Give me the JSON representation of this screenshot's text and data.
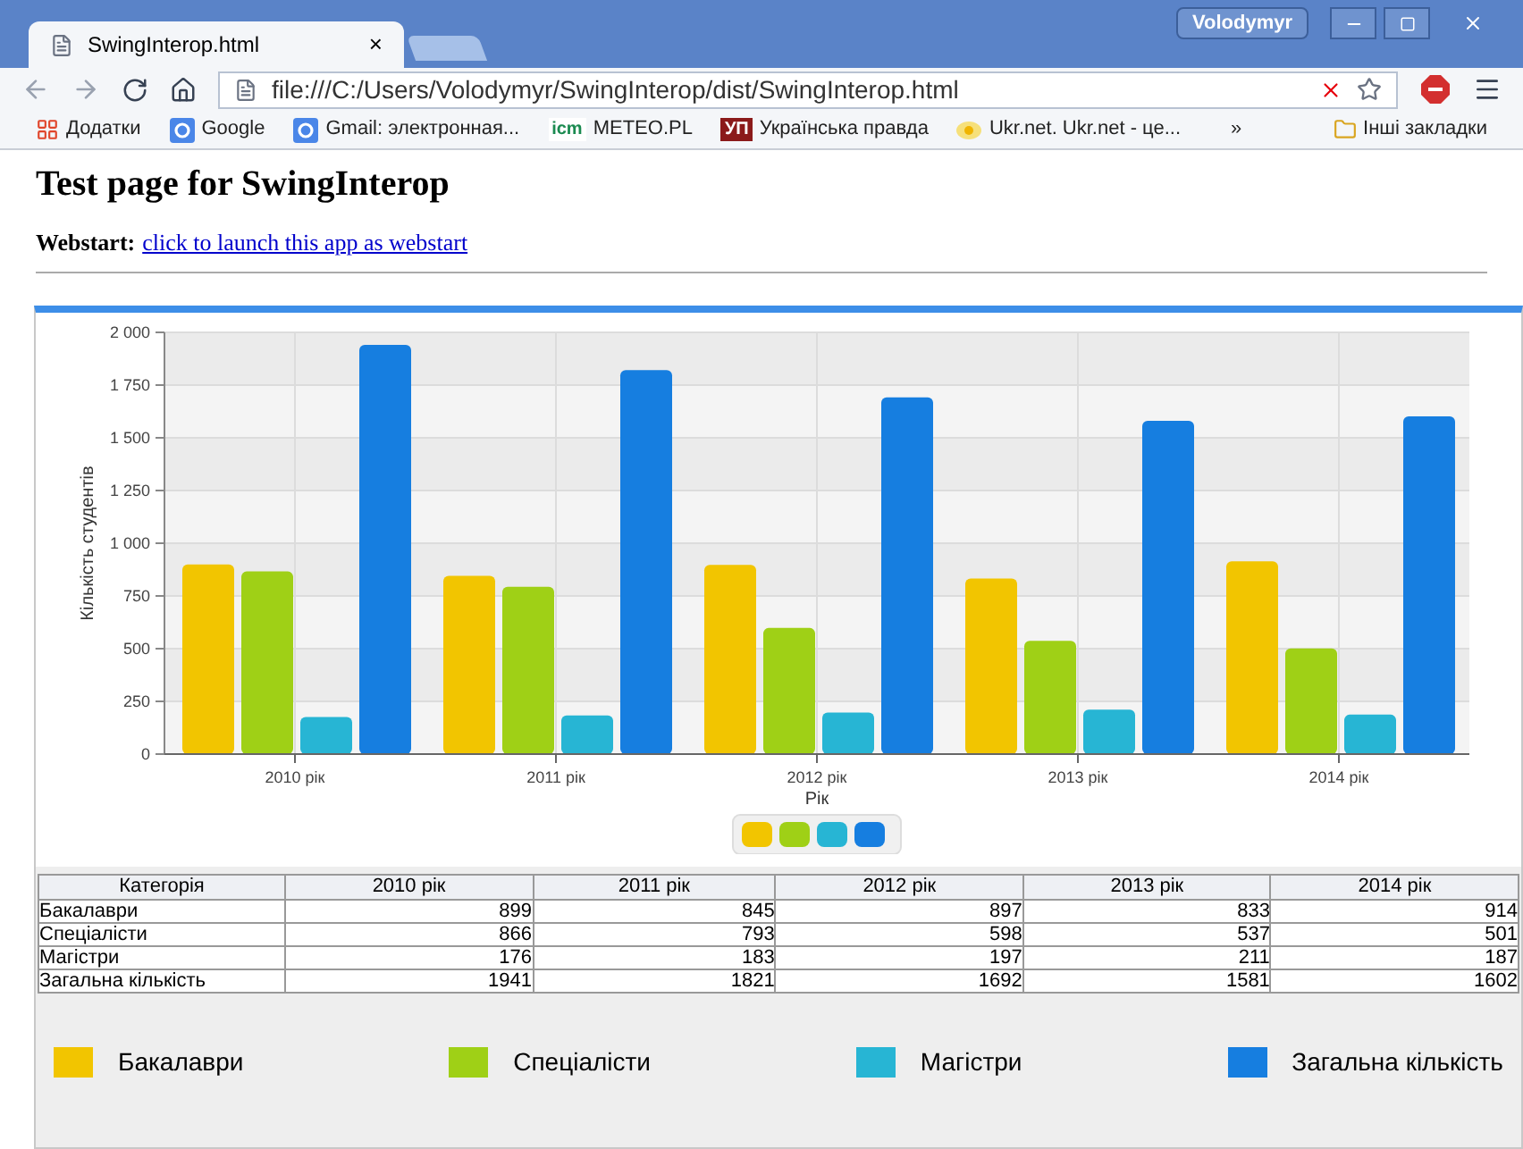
{
  "window": {
    "user": "Volodymyr"
  },
  "tab": {
    "title": "SwingInterop.html",
    "close": "×"
  },
  "address": "file:///C:/Users/Volodymyr/SwingInterop/dist/SwingInterop.html",
  "bookmarks": [
    {
      "kind": "apps",
      "label": "Додатки"
    },
    {
      "kind": "google",
      "label": "Google"
    },
    {
      "kind": "google",
      "label": "Gmail: электронная..."
    },
    {
      "kind": "icm",
      "badge": "icm",
      "label": "METEO.PL"
    },
    {
      "kind": "up",
      "badge": "УП",
      "label": "Українська правда"
    },
    {
      "kind": "ukr",
      "label": "Ukr.net. Ukr.net - це..."
    }
  ],
  "bookmarks_more": "»",
  "other_bookmarks": "Інші закладки",
  "page": {
    "heading": "Test page for SwingInterop",
    "webstart_label": "Webstart:",
    "webstart_link": "click to launch this app as webstart"
  },
  "chart": {
    "chart_data": {
      "type": "bar",
      "xlabel": "Рік",
      "ylabel": "Кількість студентів",
      "categories": [
        "2010 рік",
        "2011 рік",
        "2012 рік",
        "2013 рік",
        "2014 рік"
      ],
      "series": [
        {
          "name": "Бакалаври",
          "color": "#f2c500",
          "values": [
            899,
            845,
            897,
            833,
            914
          ]
        },
        {
          "name": "Спеціалісти",
          "color": "#9fd016",
          "values": [
            866,
            793,
            598,
            537,
            501
          ]
        },
        {
          "name": "Магістри",
          "color": "#27b5d4",
          "values": [
            176,
            183,
            197,
            211,
            187
          ]
        },
        {
          "name": "Загальна кількість",
          "color": "#167ee0",
          "values": [
            1941,
            1821,
            1692,
            1581,
            1602
          ]
        }
      ],
      "ylim": [
        0,
        2000
      ],
      "grid": true,
      "yticks": [
        {
          "value": 0,
          "label": "0"
        },
        {
          "value": 250,
          "label": "250"
        },
        {
          "value": 500,
          "label": "500"
        },
        {
          "value": 750,
          "label": "750"
        },
        {
          "value": 1000,
          "label": "1 000"
        },
        {
          "value": 1250,
          "label": "1 250"
        },
        {
          "value": 1500,
          "label": "1 500"
        },
        {
          "value": 1750,
          "label": "1 750"
        },
        {
          "value": 2000,
          "label": "2 000"
        }
      ]
    }
  },
  "table": {
    "columns": [
      "Категорія",
      "2010 рік",
      "2011 рік",
      "2012 рік",
      "2013 рік",
      "2014 рік"
    ],
    "rows": [
      [
        "Бакалаври",
        "899",
        "845",
        "897",
        "833",
        "914"
      ],
      [
        "Спеціалісти",
        "866",
        "793",
        "598",
        "537",
        "501"
      ],
      [
        "Магістри",
        "176",
        "183",
        "197",
        "211",
        "187"
      ],
      [
        "Загальна кількість",
        "1941",
        "1821",
        "1692",
        "1581",
        "1602"
      ]
    ]
  }
}
